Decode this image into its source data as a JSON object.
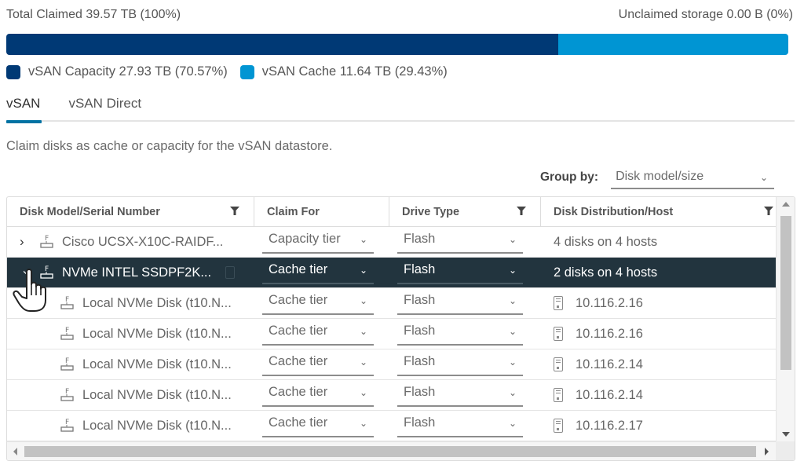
{
  "summary": {
    "total_claimed": "Total Claimed 39.57 TB (100%)",
    "unclaimed": "Unclaimed storage 0.00 B (0%)"
  },
  "storage_bar": {
    "capacity_percent": 70.57,
    "cache_percent": 29.43,
    "capacity_color": "#003975",
    "cache_color": "#0095d3"
  },
  "legend": [
    {
      "label": "vSAN Capacity 27.93 TB (70.57%)",
      "color": "#003975"
    },
    {
      "label": "vSAN Cache 11.64 TB (29.43%)",
      "color": "#0095d3"
    }
  ],
  "tabs": [
    {
      "label": "vSAN",
      "active": true
    },
    {
      "label": "vSAN Direct",
      "active": false
    }
  ],
  "description": "Claim disks as cache or capacity for the vSAN datastore.",
  "group_by": {
    "label": "Group by:",
    "value": "Disk model/size"
  },
  "table": {
    "columns": [
      {
        "label": "Disk Model/Serial Number",
        "filter": true
      },
      {
        "label": "Claim For",
        "filter": false
      },
      {
        "label": "Drive Type",
        "filter": true
      },
      {
        "label": "Disk Distribution/Host",
        "filter": true
      }
    ],
    "rows": [
      {
        "type": "group",
        "expanded": false,
        "selected": false,
        "name": "Cisco UCSX-X10C-RAIDF...",
        "claim_for": "Capacity tier",
        "drive_type": "Flash",
        "distribution": "4 disks on 4 hosts"
      },
      {
        "type": "group",
        "expanded": true,
        "selected": true,
        "name": "NVMe INTEL SSDPF2K...",
        "claim_for": "Cache tier",
        "drive_type": "Flash",
        "distribution": "2 disks on 4 hosts"
      },
      {
        "type": "child",
        "name": "Local NVMe Disk (t10.N...",
        "claim_for": "Cache tier",
        "drive_type": "Flash",
        "host": "10.116.2.16"
      },
      {
        "type": "child",
        "name": "Local NVMe Disk (t10.N...",
        "claim_for": "Cache tier",
        "drive_type": "Flash",
        "host": "10.116.2.16"
      },
      {
        "type": "child",
        "name": "Local NVMe Disk (t10.N...",
        "claim_for": "Cache tier",
        "drive_type": "Flash",
        "host": "10.116.2.14"
      },
      {
        "type": "child",
        "name": "Local NVMe Disk (t10.N...",
        "claim_for": "Cache tier",
        "drive_type": "Flash",
        "host": "10.116.2.14"
      },
      {
        "type": "child",
        "name": "Local NVMe Disk (t10.N...",
        "claim_for": "Cache tier",
        "drive_type": "Flash",
        "host": "10.116.2.17"
      }
    ]
  }
}
